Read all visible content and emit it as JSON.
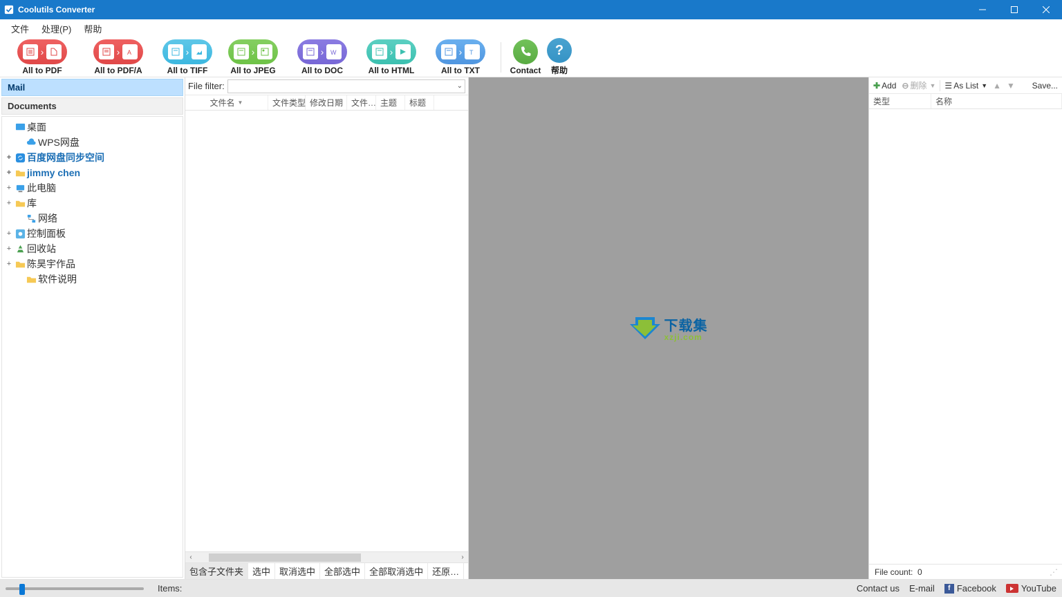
{
  "titlebar": {
    "title": "Coolutils Converter"
  },
  "menu": {
    "file": "文件",
    "process": "处理(P)",
    "help": "帮助"
  },
  "toolbar": {
    "items": [
      "All to PDF",
      "All to PDF/A",
      "All to TIFF",
      "All to JPEG",
      "All to DOC",
      "All to HTML",
      "All to TXT"
    ],
    "contact": "Contact",
    "help": "帮助"
  },
  "leftpanel": {
    "mail": "Mail",
    "documents": "Documents",
    "tree": {
      "desktop": "桌面",
      "wps": "WPS网盘",
      "baidu": "百度网盘同步空间",
      "jimmy": "jimmy chen",
      "thispc": "此电脑",
      "library": "库",
      "network": "网络",
      "controlpanel": "控制面板",
      "recycle": "回收站",
      "chen": "陈昊宇作品",
      "softdesc": "软件说明"
    }
  },
  "center": {
    "filter_label": "File filter:",
    "cols": {
      "name": "文件名",
      "type": "文件类型",
      "mdate": "修改日期",
      "file": "文件…",
      "subject": "主题",
      "title": "标题"
    },
    "selbar": {
      "subfolders": "包含子文件夹",
      "check": "选中",
      "uncheck": "取消选中",
      "checkall": "全部选中",
      "uncheckall": "全部取消选中",
      "restore": "还原…"
    }
  },
  "watermark": {
    "line1": "下载集",
    "line2": "xzji.com"
  },
  "rightpanel": {
    "add": "Add",
    "delete": "删除",
    "aslist": "As List",
    "save": "Save...",
    "col_type": "类型",
    "col_name": "名称",
    "file_count_label": "File count:",
    "file_count_val": "0"
  },
  "status": {
    "items_label": "Items:",
    "contact_us": "Contact us",
    "email": "E-mail",
    "facebook": "Facebook",
    "youtube": "YouTube"
  }
}
